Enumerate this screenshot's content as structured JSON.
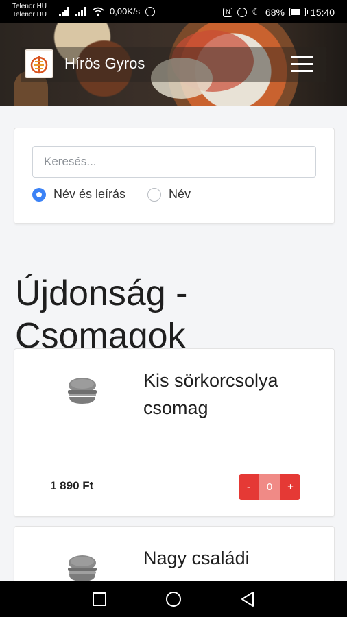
{
  "status_bar": {
    "carrier_1": "Telenor HU",
    "carrier_2": "Telenor HU",
    "speed": "0,00K/s",
    "nfc_label": "N",
    "battery": "68%",
    "time": "15:40"
  },
  "header": {
    "brand": "Hírös Gyros"
  },
  "search": {
    "placeholder": "Keresés...",
    "value": "",
    "options": [
      {
        "label": "Név és leírás",
        "checked": true
      },
      {
        "label": "Név",
        "checked": false
      }
    ]
  },
  "category": {
    "title": "Újdonság - Csomagok"
  },
  "products": [
    {
      "name": "Kis sörkorcsolya csomag",
      "price": "1 890 Ft",
      "minus_label": "-",
      "quantity": "0",
      "plus_label": "+"
    },
    {
      "name": "Nagy családi csomag"
    }
  ],
  "colors": {
    "accent_red": "#e53935",
    "radio_blue": "#3b82f6"
  },
  "icons": [
    "menu-icon",
    "burger-icon",
    "square-icon",
    "circle-icon",
    "triangle-back-icon"
  ]
}
